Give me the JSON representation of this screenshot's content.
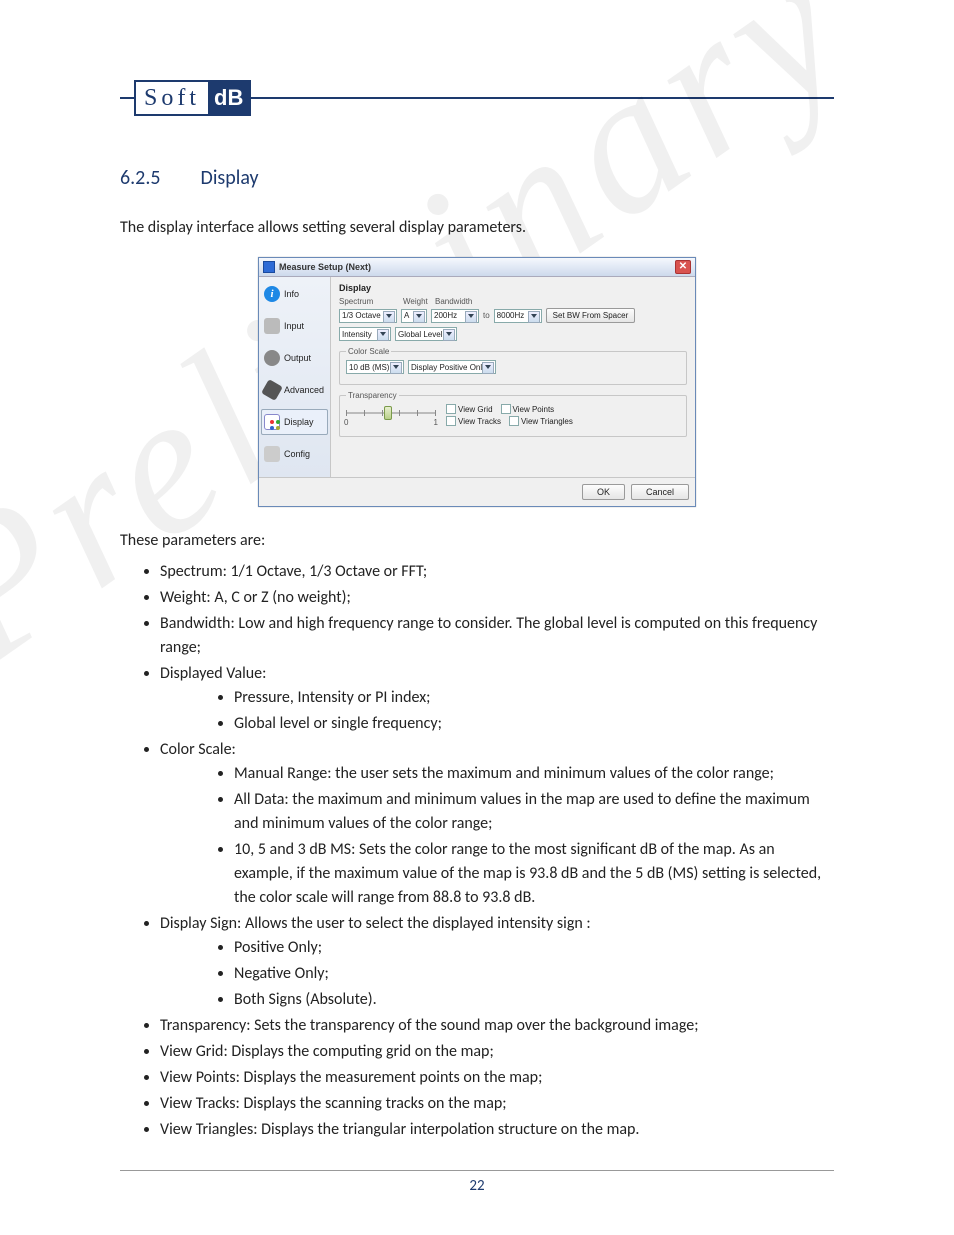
{
  "logo": {
    "left": "Soft",
    "right": "dB"
  },
  "section": {
    "number": "6.2.5",
    "title": "Display"
  },
  "intro": "The display interface allows setting several display parameters.",
  "dialog": {
    "title": "Measure Setup (Next)",
    "sidebar": {
      "items": [
        {
          "label": "Info"
        },
        {
          "label": "Input"
        },
        {
          "label": "Output"
        },
        {
          "label": "Advanced"
        },
        {
          "label": "Display"
        },
        {
          "label": "Config"
        }
      ],
      "selected_index": 4
    },
    "panel": {
      "heading": "Display",
      "spectrum_label": "Spectrum",
      "weight_label": "Weight",
      "bandwidth_label": "Bandwidth",
      "spectrum_value": "1/3 Octave",
      "weight_value": "A",
      "bw_low": "200Hz",
      "bw_to": "to",
      "bw_high": "8000Hz",
      "set_bw_button": "Set BW From Spacer",
      "intensity_value": "Intensity",
      "global_value": "Global Level",
      "color_scale_label": "Color Scale",
      "cs_value": "10 dB (MS)",
      "cs_sign": "Display Positive Only",
      "transparency_label": "Transparency",
      "slider_min": "0",
      "slider_max": "1",
      "cb_grid": "View Grid",
      "cb_points": "View Points",
      "cb_tracks": "View Tracks",
      "cb_tri": "View Triangles"
    },
    "buttons": {
      "ok": "OK",
      "cancel": "Cancel"
    }
  },
  "params_intro": "These parameters are:",
  "bullets": [
    {
      "text": "Spectrum: 1/1 Octave, 1/3 Octave or FFT;"
    },
    {
      "text": "Weight: A, C or Z (no weight);"
    },
    {
      "text": "Bandwidth: Low and high frequency range to consider. The global level is computed on this frequency range;"
    },
    {
      "text": "Displayed Value:",
      "children": [
        "Pressure, Intensity or PI index;",
        "Global level or single frequency;"
      ]
    },
    {
      "text": "Color Scale:",
      "children": [
        "Manual Range: the user sets the maximum and minimum values of the color range;",
        "All Data: the maximum and minimum values in the map are used to define the maximum and minimum values of the color range;",
        "10, 5 and 3 dB MS: Sets the color range to the most significant dB of the map. As an example, if the maximum value of the map is 93.8 dB and the 5 dB (MS) setting is selected, the color scale will range from 88.8 to 93.8 dB."
      ]
    },
    {
      "text": "Display Sign: Allows the user to select the displayed intensity sign :",
      "children": [
        "Positive Only;",
        "Negative Only;",
        "Both Signs (Absolute)."
      ]
    },
    {
      "text": "Transparency: Sets the transparency of the sound map over the background image;"
    },
    {
      "text": "View Grid: Displays the computing grid on the map;"
    },
    {
      "text": "View Points: Displays the measurement points on the map;"
    },
    {
      "text": "View Tracks: Displays the scanning tracks on the map;"
    },
    {
      "text": "View Triangles: Displays the triangular interpolation structure on the map."
    }
  ],
  "page_number": "22",
  "watermark": "Preliminary"
}
